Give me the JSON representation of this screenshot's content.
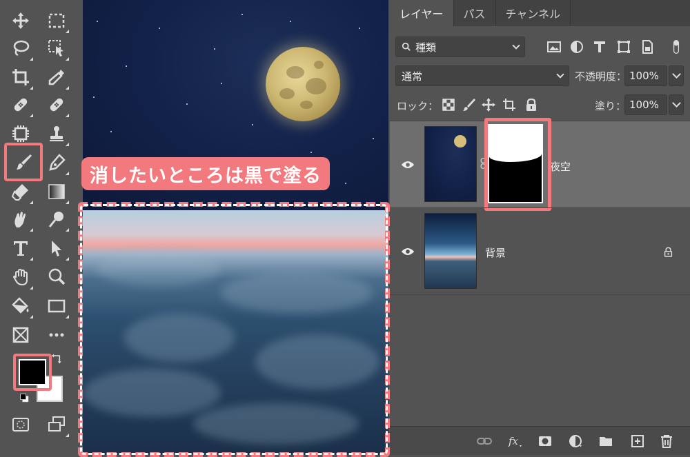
{
  "canvas": {
    "annotation": "消したいところは黒で塗る"
  },
  "tabs": [
    {
      "label": "レイヤー"
    },
    {
      "label": "パス"
    },
    {
      "label": "チャンネル"
    }
  ],
  "filter": {
    "kind_label": "種類"
  },
  "blend": {
    "mode": "通常",
    "opacity_label": "不透明度：",
    "opacity_value": "100%"
  },
  "lock": {
    "label": "ロック：",
    "fill_label": "塗り：",
    "fill_value": "100%"
  },
  "layers": [
    {
      "name": "夜空",
      "selected": true,
      "has_mask": true
    },
    {
      "name": "背景",
      "selected": false,
      "locked": true
    }
  ],
  "colors": {
    "accent": "#f27a7e",
    "foreground": "#000000",
    "background": "#ffffff"
  }
}
